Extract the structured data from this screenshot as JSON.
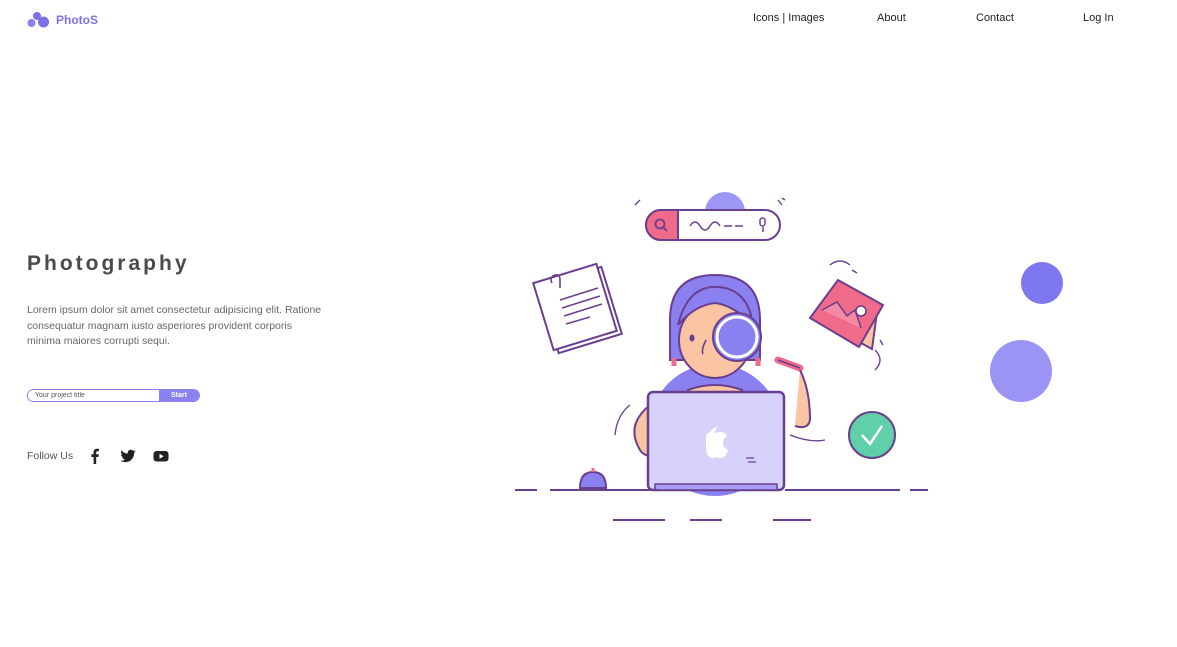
{
  "brand": {
    "name": "PhotoS",
    "color": "#7b72e6"
  },
  "nav": {
    "items": [
      {
        "label": "Icons | Images"
      },
      {
        "label": "About"
      },
      {
        "label": "Contact"
      },
      {
        "label": "Log In"
      }
    ]
  },
  "hero": {
    "title": "Photography",
    "description": "Lorem ipsum dolor sit amet consectetur adipisicing elit. Ratione consequatur magnam iusto asperiores provident corporis minima maiores corrupti sequi."
  },
  "project_form": {
    "placeholder": "Your project title",
    "value": "",
    "button_label": "Start"
  },
  "social": {
    "label": "Follow Us",
    "icons": [
      "facebook-icon",
      "twitter-icon",
      "youtube-icon"
    ]
  },
  "colors": {
    "accent": "#8a80f0",
    "dark_purple": "#6b3f8f",
    "pink": "#f06a8a",
    "teal": "#5fd0a8",
    "skin": "#fbc4a3"
  }
}
